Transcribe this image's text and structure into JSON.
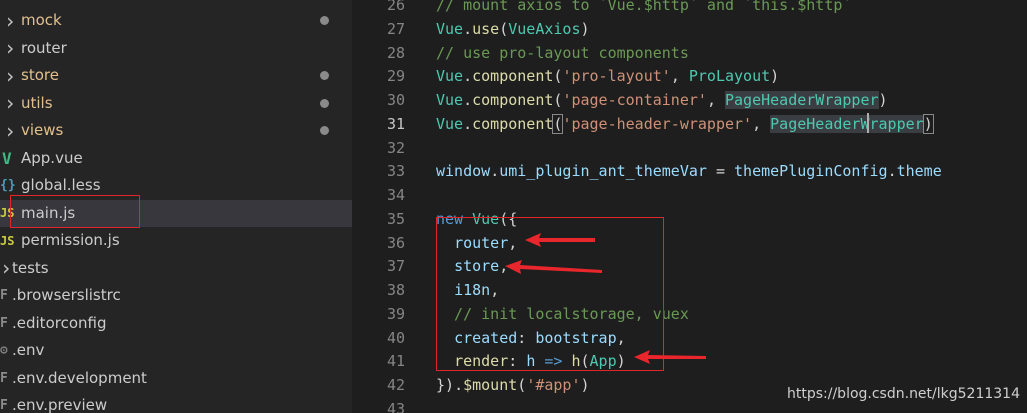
{
  "explorer": {
    "items": [
      {
        "label": "mock",
        "icon": "chevron-right-icon",
        "modified": true
      },
      {
        "label": "router",
        "icon": "chevron-right-icon",
        "modified": false
      },
      {
        "label": "store",
        "icon": "chevron-right-icon",
        "modified": true
      },
      {
        "label": "utils",
        "icon": "chevron-right-icon",
        "modified": true
      },
      {
        "label": "views",
        "icon": "chevron-right-icon",
        "modified": true
      },
      {
        "label": "App.vue",
        "icon": "vue-file-icon",
        "modified": false
      },
      {
        "label": "global.less",
        "icon": "less-file-icon",
        "modified": false
      },
      {
        "label": "main.js",
        "icon": "js-file-icon",
        "modified": false,
        "selected": true
      },
      {
        "label": "permission.js",
        "icon": "js-file-icon",
        "modified": false
      },
      {
        "label": "tests",
        "icon": "folder-icon",
        "modified": false
      },
      {
        "label": ".browserslistrc",
        "icon": "config-file-icon",
        "modified": false
      },
      {
        "label": ".editorconfig",
        "icon": "config-file-icon",
        "modified": false
      },
      {
        "label": ".env",
        "icon": "env-file-icon",
        "modified": false
      },
      {
        "label": ".env.development",
        "icon": "config-file-icon",
        "modified": false
      },
      {
        "label": ".env.preview",
        "icon": "config-file-icon",
        "modified": false
      }
    ]
  },
  "editor": {
    "lines": [
      {
        "n": "26",
        "tokens": [
          [
            "// mount axios to `Vue.$http` and `this.$http`",
            "cmt"
          ]
        ]
      },
      {
        "n": "27",
        "tokens": [
          [
            "Vue",
            "cls"
          ],
          [
            ".",
            "pun"
          ],
          [
            "use",
            "fn"
          ],
          [
            "(",
            "pun"
          ],
          [
            "VueAxios",
            "cls"
          ],
          [
            ")",
            "pun"
          ]
        ]
      },
      {
        "n": "28",
        "tokens": [
          [
            "// use pro-layout components",
            "cmt"
          ]
        ]
      },
      {
        "n": "29",
        "tokens": [
          [
            "Vue",
            "cls"
          ],
          [
            ".",
            "pun"
          ],
          [
            "component",
            "fn"
          ],
          [
            "(",
            "pun"
          ],
          [
            "'pro-layout'",
            "str"
          ],
          [
            ", ",
            "pun"
          ],
          [
            "ProLayout",
            "cls"
          ],
          [
            ")",
            "pun"
          ]
        ]
      },
      {
        "n": "30",
        "tokens": [
          [
            "Vue",
            "cls"
          ],
          [
            ".",
            "pun"
          ],
          [
            "component",
            "fn"
          ],
          [
            "(",
            "pun"
          ],
          [
            "'page-container'",
            "str"
          ],
          [
            ", ",
            "pun"
          ],
          [
            "PageHeaderWrapper",
            "cls hl"
          ],
          [
            ")",
            "pun"
          ]
        ]
      },
      {
        "n": "31",
        "active": true,
        "tokens": [
          [
            "Vue",
            "cls"
          ],
          [
            ".",
            "pun"
          ],
          [
            "component",
            "fn"
          ],
          [
            "(",
            "pun br"
          ],
          [
            "'page-header-wrapper'",
            "str"
          ],
          [
            ", ",
            "pun"
          ],
          [
            "PageHeaderWrapper",
            "cls hl"
          ],
          [
            ")",
            "pun br"
          ]
        ]
      },
      {
        "n": "32",
        "tokens": []
      },
      {
        "n": "33",
        "tokens": [
          [
            "window",
            "var"
          ],
          [
            ".",
            "pun"
          ],
          [
            "umi_plugin_ant_themeVar",
            "var"
          ],
          [
            " = ",
            "pun"
          ],
          [
            "themePluginConfig",
            "var"
          ],
          [
            ".",
            "pun"
          ],
          [
            "theme",
            "var"
          ]
        ]
      },
      {
        "n": "34",
        "tokens": []
      },
      {
        "n": "35",
        "tokens": [
          [
            "new",
            "kw"
          ],
          [
            " ",
            "pun"
          ],
          [
            "Vue",
            "cls"
          ],
          [
            "({",
            "pun"
          ]
        ]
      },
      {
        "n": "36",
        "tokens": [
          [
            "  ",
            "pun"
          ],
          [
            "router",
            "var"
          ],
          [
            ",",
            "pun"
          ]
        ]
      },
      {
        "n": "37",
        "tokens": [
          [
            "  ",
            "pun"
          ],
          [
            "store",
            "var"
          ],
          [
            ",",
            "pun"
          ]
        ]
      },
      {
        "n": "38",
        "tokens": [
          [
            "  ",
            "pun"
          ],
          [
            "i18n",
            "var"
          ],
          [
            ",",
            "pun"
          ]
        ]
      },
      {
        "n": "39",
        "tokens": [
          [
            "  // init localstorage, vuex",
            "cmt"
          ]
        ]
      },
      {
        "n": "40",
        "tokens": [
          [
            "  ",
            "pun"
          ],
          [
            "created",
            "var"
          ],
          [
            ": ",
            "pun"
          ],
          [
            "bootstrap",
            "var"
          ],
          [
            ",",
            "pun"
          ]
        ]
      },
      {
        "n": "41",
        "tokens": [
          [
            "  ",
            "pun"
          ],
          [
            "render",
            "fn"
          ],
          [
            ": ",
            "pun"
          ],
          [
            "h",
            "var"
          ],
          [
            " ",
            "pun"
          ],
          [
            "=>",
            "kw"
          ],
          [
            " ",
            "pun"
          ],
          [
            "h",
            "fn"
          ],
          [
            "(",
            "pun"
          ],
          [
            "App",
            "cls"
          ],
          [
            ")",
            "pun"
          ]
        ]
      },
      {
        "n": "42",
        "tokens": [
          [
            "})",
            "pun"
          ],
          [
            ".",
            "pun"
          ],
          [
            "$mount",
            "fn"
          ],
          [
            "(",
            "pun"
          ],
          [
            "'#app'",
            "str"
          ],
          [
            ")",
            "pun"
          ]
        ]
      },
      {
        "n": "43",
        "tokens": []
      }
    ]
  },
  "watermark": "https://blog.csdn.net/lkg5211314"
}
